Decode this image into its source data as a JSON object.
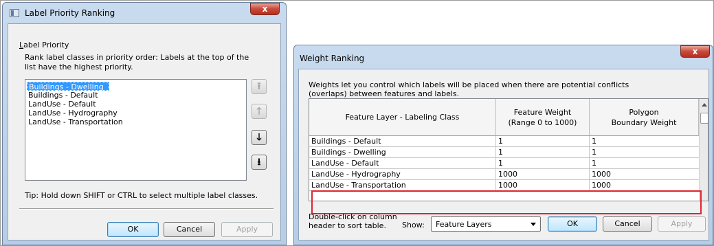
{
  "label_priority_dialog": {
    "title": "Label Priority Ranking",
    "close_label": "x",
    "group_title_accel": "L",
    "group_title_rest": "abel Priority",
    "description": "Rank label classes in priority order: Labels at the top of the list have the highest priority.",
    "items": [
      {
        "label": "Buildings - Dwelling",
        "selected": true
      },
      {
        "label": "Buildings - Default",
        "selected": false
      },
      {
        "label": "LandUse - Default",
        "selected": false
      },
      {
        "label": "LandUse - Hydrography",
        "selected": false
      },
      {
        "label": "LandUse - Transportation",
        "selected": false
      }
    ],
    "move_buttons": {
      "top_icon": "⭱",
      "up_icon": "🡑",
      "down_icon": "🡓",
      "bottom_icon": "⭳"
    },
    "tip": "Tip: Hold down SHIFT or CTRL to select multiple label classes.",
    "ok_label": "OK",
    "cancel_label": "Cancel",
    "apply_label": "Apply"
  },
  "weight_ranking_dialog": {
    "title": "Weight Ranking",
    "close_label": "x",
    "description": "Weights let you control which labels will be placed when there are potential conflicts (overlaps) between features and labels.",
    "columns": [
      "Feature Layer - Labeling Class",
      "Feature Weight\n(Range 0 to 1000)",
      "Polygon\nBoundary Weight"
    ],
    "rows": [
      {
        "layer": "Buildings - Default",
        "feature_weight": "1",
        "polygon_weight": "1"
      },
      {
        "layer": "Buildings - Dwelling",
        "feature_weight": "1",
        "polygon_weight": "1"
      },
      {
        "layer": "LandUse - Default",
        "feature_weight": "1",
        "polygon_weight": "1"
      },
      {
        "layer": "LandUse - Hydrography",
        "feature_weight": "1000",
        "polygon_weight": "1000"
      },
      {
        "layer": "LandUse - Transportation",
        "feature_weight": "1000",
        "polygon_weight": "1000"
      }
    ],
    "hint_line1": "Double-click on column",
    "hint_line2": "header to sort table.",
    "show_label": "Show:",
    "show_value": "Feature Layers",
    "ok_label": "OK",
    "cancel_label": "Cancel",
    "apply_label": "Apply",
    "highlight_color": "#e0242f"
  }
}
